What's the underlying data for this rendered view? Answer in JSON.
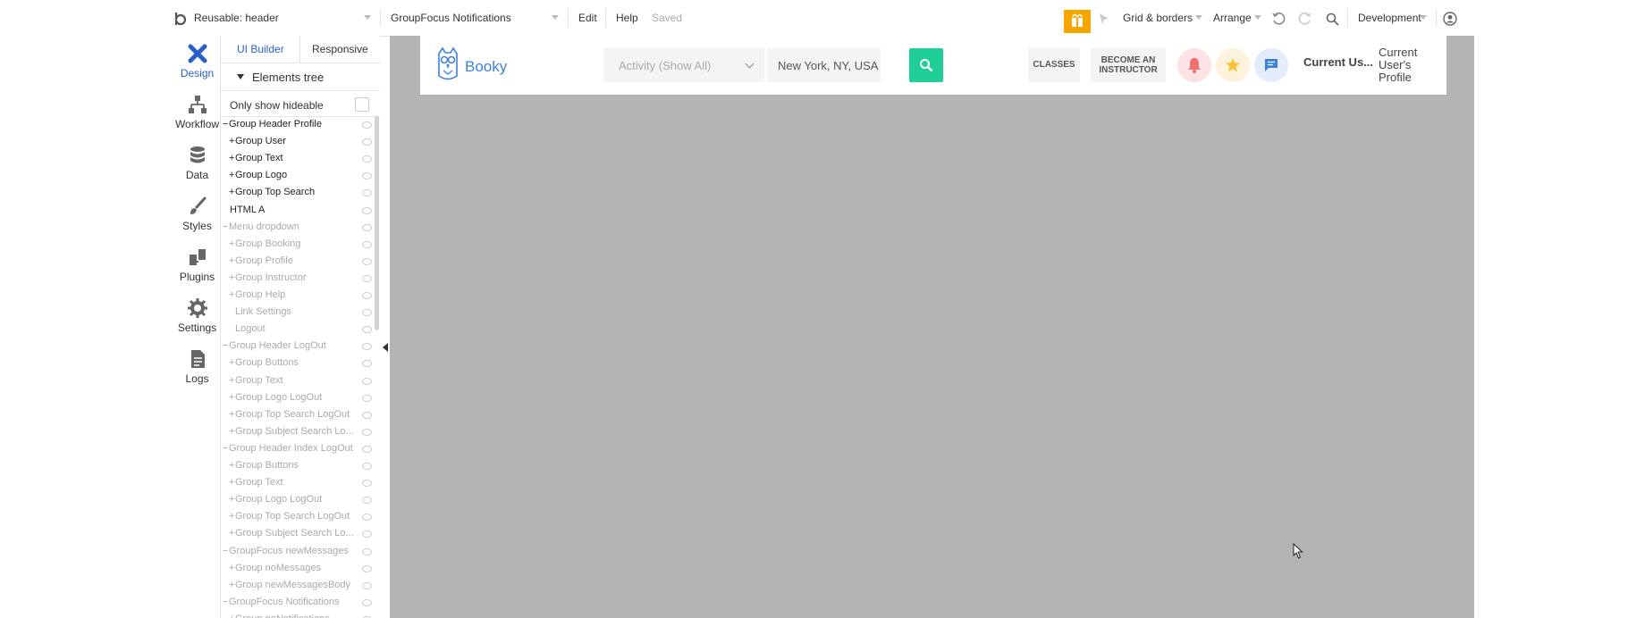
{
  "topbar": {
    "page_selector": "Reusable: header",
    "element_selector": "GroupFocus Notifications",
    "edit": "Edit",
    "help": "Help",
    "status": "Saved",
    "grid_borders": "Grid & borders",
    "arrange": "Arrange",
    "environment": "Development"
  },
  "nav": {
    "design": "Design",
    "workflow": "Workflow",
    "data": "Data",
    "styles": "Styles",
    "plugins": "Plugins",
    "settings": "Settings",
    "logs": "Logs"
  },
  "panel": {
    "tab_ui": "UI Builder",
    "tab_responsive": "Responsive",
    "tree_title": "Elements tree",
    "only_hideable": "Only show hideable"
  },
  "tree": [
    {
      "label": "Group Header Profile",
      "prefix": "−",
      "indent": 0,
      "dim": false
    },
    {
      "label": "Group User",
      "prefix": "+",
      "indent": 1,
      "dim": false
    },
    {
      "label": "Group Text",
      "prefix": "+",
      "indent": 1,
      "dim": false
    },
    {
      "label": "Group Logo",
      "prefix": "+",
      "indent": 1,
      "dim": false
    },
    {
      "label": "Group Top Search",
      "prefix": "+",
      "indent": 1,
      "dim": false
    },
    {
      "label": "HTML A",
      "prefix": "",
      "indent": 0,
      "dim": false
    },
    {
      "label": "Menu dropdown",
      "prefix": "−",
      "indent": 0,
      "dim": true
    },
    {
      "label": "Group Booking",
      "prefix": "+",
      "indent": 1,
      "dim": true
    },
    {
      "label": "Group Profile",
      "prefix": "+",
      "indent": 1,
      "dim": true
    },
    {
      "label": "Group Instructor",
      "prefix": "+",
      "indent": 1,
      "dim": true
    },
    {
      "label": "Group Help",
      "prefix": "+",
      "indent": 1,
      "dim": true
    },
    {
      "label": "Link Settings",
      "prefix": "",
      "indent": 1,
      "dim": true
    },
    {
      "label": "Logout",
      "prefix": "",
      "indent": 1,
      "dim": true
    },
    {
      "label": "Group Header LogOut",
      "prefix": "−",
      "indent": 0,
      "dim": true
    },
    {
      "label": "Group Buttons",
      "prefix": "+",
      "indent": 1,
      "dim": true
    },
    {
      "label": "Group Text",
      "prefix": "+",
      "indent": 1,
      "dim": true
    },
    {
      "label": "Group Logo LogOut",
      "prefix": "+",
      "indent": 1,
      "dim": true
    },
    {
      "label": "Group Top Search LogOut",
      "prefix": "+",
      "indent": 1,
      "dim": true
    },
    {
      "label": "Group Subject Search Lo...",
      "prefix": "+",
      "indent": 1,
      "dim": true
    },
    {
      "label": "Group Header Index LogOut",
      "prefix": "−",
      "indent": 0,
      "dim": true
    },
    {
      "label": "Group Buttons",
      "prefix": "+",
      "indent": 1,
      "dim": true
    },
    {
      "label": "Group Text",
      "prefix": "+",
      "indent": 1,
      "dim": true
    },
    {
      "label": "Group Logo LogOut",
      "prefix": "+",
      "indent": 1,
      "dim": true
    },
    {
      "label": "Group Top Search LogOut",
      "prefix": "+",
      "indent": 1,
      "dim": true
    },
    {
      "label": "Group Subject Search Lo...",
      "prefix": "+",
      "indent": 1,
      "dim": true
    },
    {
      "label": "GroupFocus newMessages",
      "prefix": "−",
      "indent": 0,
      "dim": true
    },
    {
      "label": "Group noMessages",
      "prefix": "+",
      "indent": 1,
      "dim": true
    },
    {
      "label": "Group newMessagesBody",
      "prefix": "+",
      "indent": 1,
      "dim": true
    },
    {
      "label": "GroupFocus Notifications",
      "prefix": "−",
      "indent": 0,
      "dim": true
    },
    {
      "label": "Group noNotifications",
      "prefix": "+",
      "indent": 1,
      "dim": true
    }
  ],
  "header": {
    "brand": "Booky",
    "activity_select": "Activity (Show All)",
    "location": "New York, NY, USA",
    "classes": "CLASSES",
    "become_line1": "BECOME AN",
    "become_line2": "INSTRUCTOR",
    "current_user": "Current Us...",
    "current_profile": "Current User's Profile"
  },
  "colors": {
    "accent_blue": "#2a5ec8",
    "brand_blue": "#3c82d8",
    "search_green": "#1fcf97",
    "canvas_grey": "#b4b4b4",
    "gift_orange": "#f5a700"
  }
}
